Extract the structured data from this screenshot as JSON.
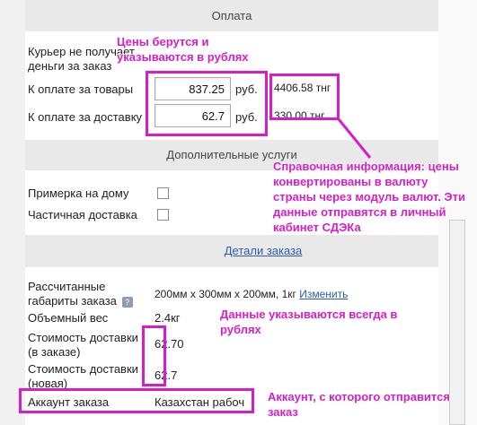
{
  "payment": {
    "title": "Оплата",
    "courier_label": "Курьер не получает деньги за заказ",
    "goods_label": "К оплате за товары",
    "goods_value": "837.25",
    "goods_currency": "руб.",
    "goods_converted": "4406.58 тнг",
    "delivery_label": "К оплате за доставку",
    "delivery_value": "62.7",
    "delivery_currency": "руб.",
    "delivery_converted": "330.00 тнг"
  },
  "extra": {
    "title": "Дополнительные услуги",
    "fitting_label": "Примерка на дому",
    "partial_label": "Частичная доставка"
  },
  "details_link": "Детали заказа",
  "order": {
    "dims_label": "Рассчитанные габариты заказа",
    "dims_value": "200мм х 300мм х 200мм, 1кг",
    "dims_change": "Изменить",
    "volume_label": "Объемный вес",
    "volume_value": "2.4кг",
    "cost_order_label": "Стоимость доставки (в заказе)",
    "cost_order_value": "62.70",
    "cost_new_label": "Стоимость доставки (новая)",
    "cost_new_value": "62.7",
    "account_label": "Аккаунт заказа",
    "account_value": "Казахстан рабоч"
  },
  "notes": {
    "prices": "Цены берутся и указываются в рублях",
    "reference": "Справочная информация: цены конвертированы в валюту страны через модуль валют. Эти данные отправятся в личный кабинет СДЭКа",
    "rubles": "Данные указываются всегда в рублях",
    "account": "Аккаунт, с которого отправится заказ"
  },
  "colors": {
    "annotation": "#d61ec8",
    "section_bg": "#e9e9e9",
    "link": "#2a5fad"
  }
}
